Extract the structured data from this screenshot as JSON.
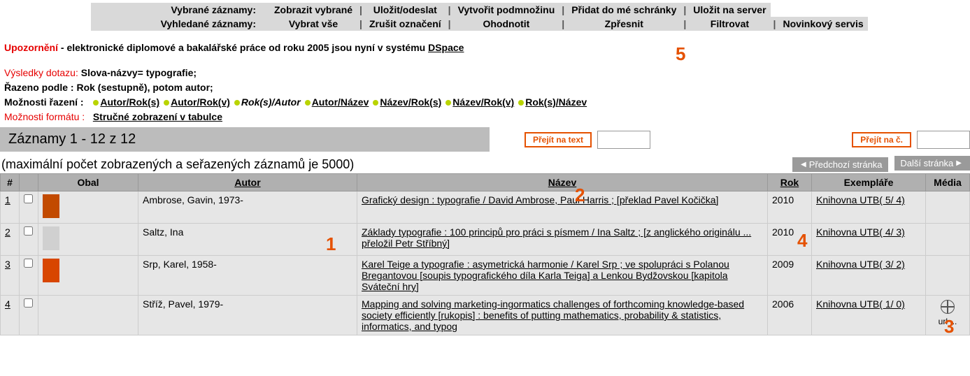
{
  "toolbar": {
    "selected_label": "Vybrané záznamy:",
    "searched_label": "Vyhledané záznamy:",
    "row1": [
      "Zobrazit vybrané",
      "Uložit/odeslat",
      "Vytvořit podmnožinu",
      "Přidat do mé schránky",
      "Uložit na server"
    ],
    "row2": [
      "Vybrat vše",
      "Zrušit označení",
      "Ohodnotit",
      "Zpřesnit",
      "Filtrovat",
      "Novinkový servis"
    ]
  },
  "warning": {
    "label": "Upozornění",
    "text_before": " - elektronické diplomové a bakalářské práce od roku 2005 jsou nyní v systému ",
    "link": "DSpace"
  },
  "query": {
    "results_label": "Výsledky dotazu:",
    "results_value": " Slova-názvy= typografie;",
    "sorted_label": "Řazeno podle :",
    "sorted_value": " Rok (sestupně), potom autor;",
    "sortopts_label": "Možnosti řazení :",
    "sort_options": [
      "Autor/Rok(s)",
      "Autor/Rok(v)",
      "Rok(s)/Autor",
      "Autor/Název",
      "Název/Rok(s)",
      "Název/Rok(v)",
      "Rok(s)/Název"
    ],
    "sort_current_index": 2,
    "fmt_label": "Možnosti formátu :",
    "fmt_link": "Stručné zobrazení v tabulce"
  },
  "records_count": "Záznamy 1 - 12 z 12",
  "jump_text_label": "Přejít na text",
  "jump_num_label": "Přejít na č.",
  "max_note": "(maximální počet zobrazených a seřazených záznamů je 5000)",
  "pager_prev": "Předchozí stránka",
  "pager_next": "Další stránka",
  "columns": {
    "idx": "#",
    "cover": "Obal",
    "author": "Autor",
    "title": "Název",
    "year": "Rok",
    "holdings": "Exempláře",
    "media": "Média"
  },
  "rows": [
    {
      "n": "1",
      "cover_color": "#c24a00",
      "author": "Ambrose, Gavin, 1973-",
      "title": "Grafický design : typografie / David Ambrose, Paul Harris ; [překlad Pavel Kočička]",
      "year": "2010",
      "holdings": "Knihovna UTB( 5/ 4)",
      "media": ""
    },
    {
      "n": "2",
      "cover_color": "#d0d0d0",
      "author": "Saltz, Ina",
      "title": "Základy typografie : 100 principů pro práci s písmem / Ina Saltz ; [z anglického originálu ... přeložil Petr Stříbný]",
      "year": "2010",
      "holdings": "Knihovna UTB( 4/ 3)",
      "media": ""
    },
    {
      "n": "3",
      "cover_color": "#d84600",
      "author": "Srp, Karel, 1958-",
      "title": "Karel Teige a typografie : asymetrická harmonie / Karel Srp ; ve spolupráci s Polanou Bregantovou [soupis typografického díla Karla Teiga] a Lenkou Bydžovskou [kapitola Sváteční hry]",
      "year": "2009",
      "holdings": "Knihovna UTB( 3/ 2)",
      "media": ""
    },
    {
      "n": "4",
      "cover_color": "",
      "author": "Stříž, Pavel, 1979-",
      "title": "Mapping and solving marketing-ingormatics challenges of forthcoming knowledge-based society efficiently [rukopis] : benefits of putting mathematics, probability & statistics, informatics, and typog",
      "year": "2006",
      "holdings": "Knihovna UTB( 1/ 0)",
      "media": "url ..."
    }
  ],
  "annotations": {
    "a1": "1",
    "a2": "2",
    "a3": "3",
    "a4": "4",
    "a5": "5"
  }
}
